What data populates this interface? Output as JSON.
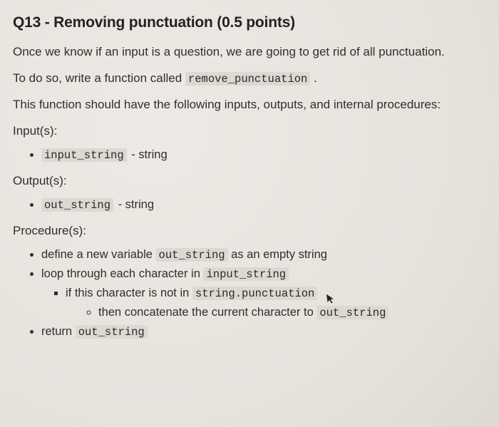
{
  "title": "Q13 - Removing punctuation (0.5 points)",
  "p1": "Once we know if an input is a question, we are going to get rid of all punctuation.",
  "p2_pre": "To do so, write a function called ",
  "p2_code": "remove_punctuation",
  "p2_post": " .",
  "p3": "This function should have the following inputs, outputs, and internal procedures:",
  "inputs_label": "Input(s):",
  "input_item_code": "input_string",
  "input_item_suffix": " - string",
  "outputs_label": "Output(s):",
  "output_item_code": "out_string",
  "output_item_suffix": " - string",
  "procedures_label": "Procedure(s):",
  "proc1_pre": "define a new variable ",
  "proc1_code": "out_string",
  "proc1_post": " as an empty string",
  "proc2_pre": "loop through each character in ",
  "proc2_code": "input_string",
  "proc3_pre": "if this character is not in ",
  "proc3_code": "string.punctuation",
  "proc4_pre": "then concatenate the current character to ",
  "proc4_code": "out_string",
  "proc5_pre": "return ",
  "proc5_code": "out_string"
}
